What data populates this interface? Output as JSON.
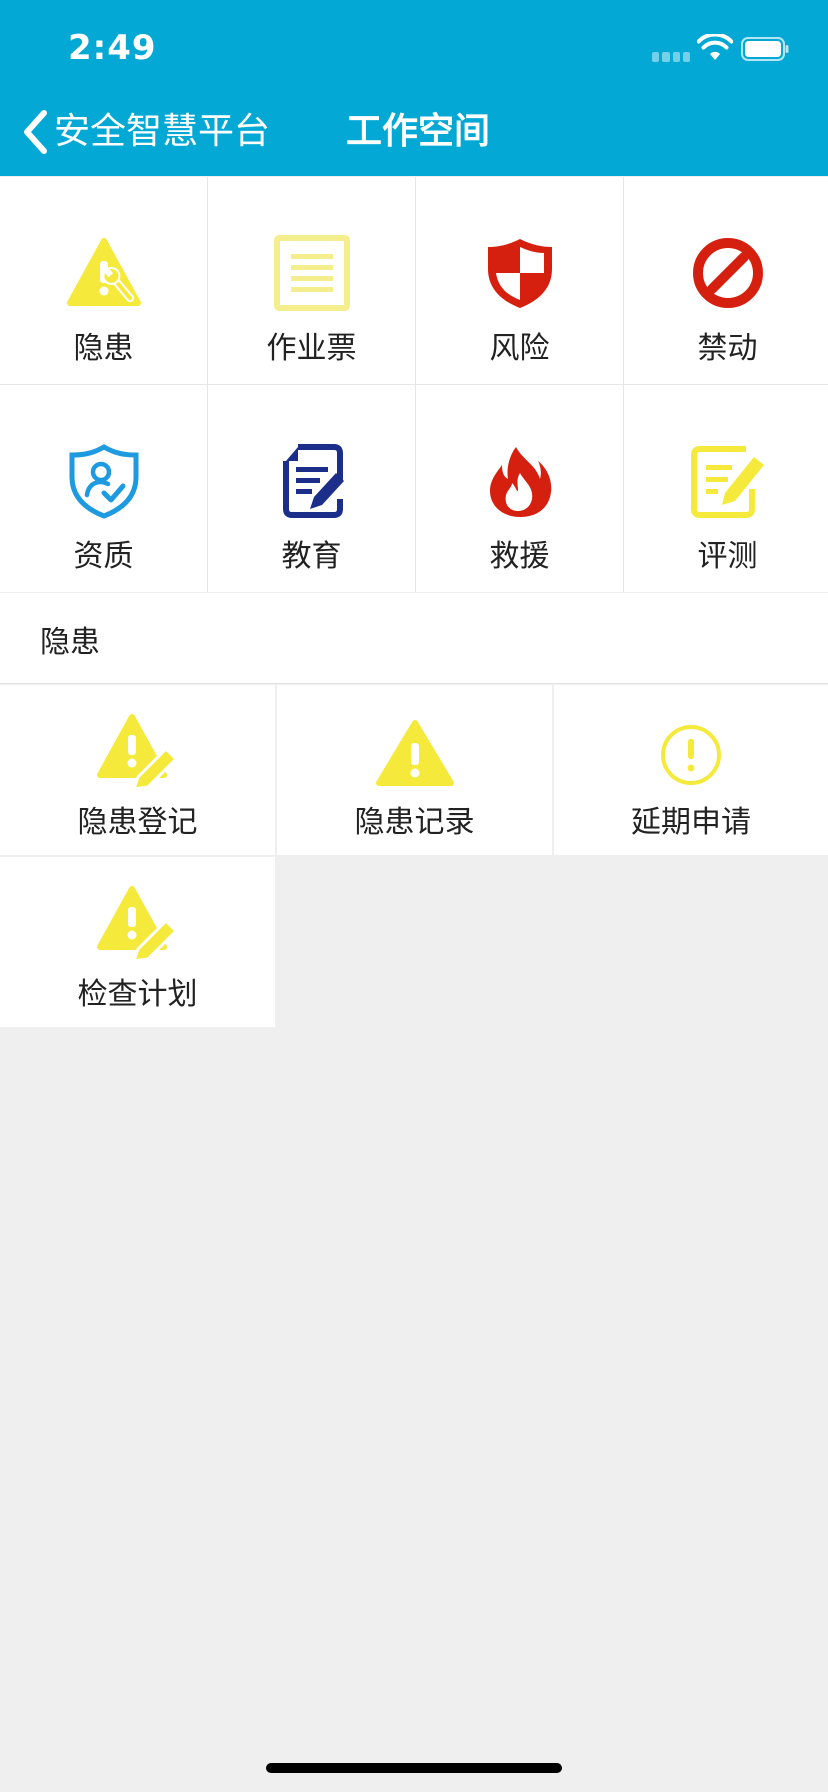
{
  "status_bar": {
    "time": "2:49"
  },
  "nav": {
    "back_label": "安全智慧平台",
    "title": "工作空间"
  },
  "main_grid": [
    {
      "label": "隐患",
      "icon": "hazard-wrench-icon"
    },
    {
      "label": "作业票",
      "icon": "document-lines-icon"
    },
    {
      "label": "风险",
      "icon": "shield-icon"
    },
    {
      "label": "禁动",
      "icon": "prohibited-icon"
    },
    {
      "label": "资质",
      "icon": "shield-user-check-icon"
    },
    {
      "label": "教育",
      "icon": "document-edit-icon"
    },
    {
      "label": "救援",
      "icon": "flame-icon"
    },
    {
      "label": "评测",
      "icon": "note-edit-icon"
    }
  ],
  "section": {
    "title": "隐患"
  },
  "sub_items": [
    {
      "label": "隐患登记",
      "icon": "warning-pencil-icon"
    },
    {
      "label": "隐患记录",
      "icon": "warning-icon"
    },
    {
      "label": "延期申请",
      "icon": "exclamation-circle-icon"
    },
    {
      "label": "检查计划",
      "icon": "warning-pencil-icon"
    }
  ],
  "colors": {
    "header": "#03a9d4",
    "yellow": "#f5ea3b",
    "red": "#d6200f",
    "blue": "#1e9be0",
    "navy": "#1b2f8a"
  }
}
